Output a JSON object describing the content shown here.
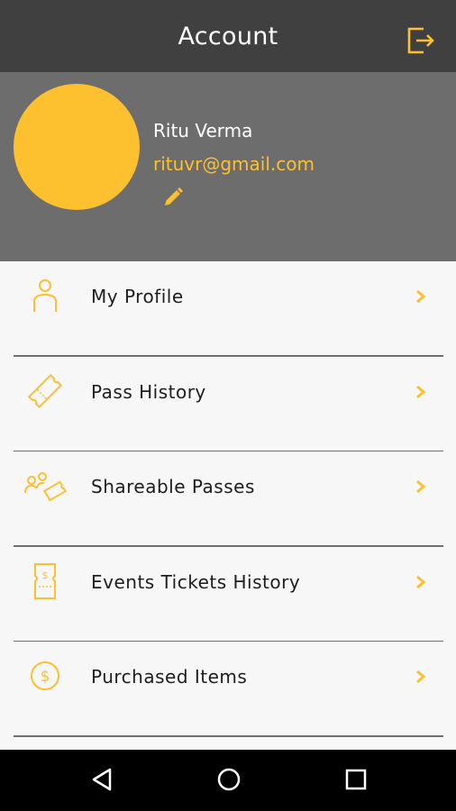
{
  "header": {
    "title": "Account",
    "logout_icon": "logout-icon"
  },
  "profile": {
    "name": "Ritu Verma",
    "email": "rituvr@gmail.com",
    "avatar_color": "#fdc02f",
    "edit_icon": "pencil-icon"
  },
  "menu": {
    "items": [
      {
        "label": "My Profile",
        "icon": "person-icon"
      },
      {
        "label": "Pass History",
        "icon": "ticket-icon"
      },
      {
        "label": "Shareable Passes",
        "icon": "share-pass-icon"
      },
      {
        "label": "Events Tickets History",
        "icon": "event-ticket-icon"
      },
      {
        "label": "Purchased Items",
        "icon": "dollar-coin-icon"
      }
    ]
  },
  "colors": {
    "accent": "#fdc02f",
    "header_bg": "#404040",
    "profile_bg": "#6d6d6d"
  },
  "navbar": {
    "buttons": [
      "back-icon",
      "home-icon",
      "recents-icon"
    ]
  }
}
